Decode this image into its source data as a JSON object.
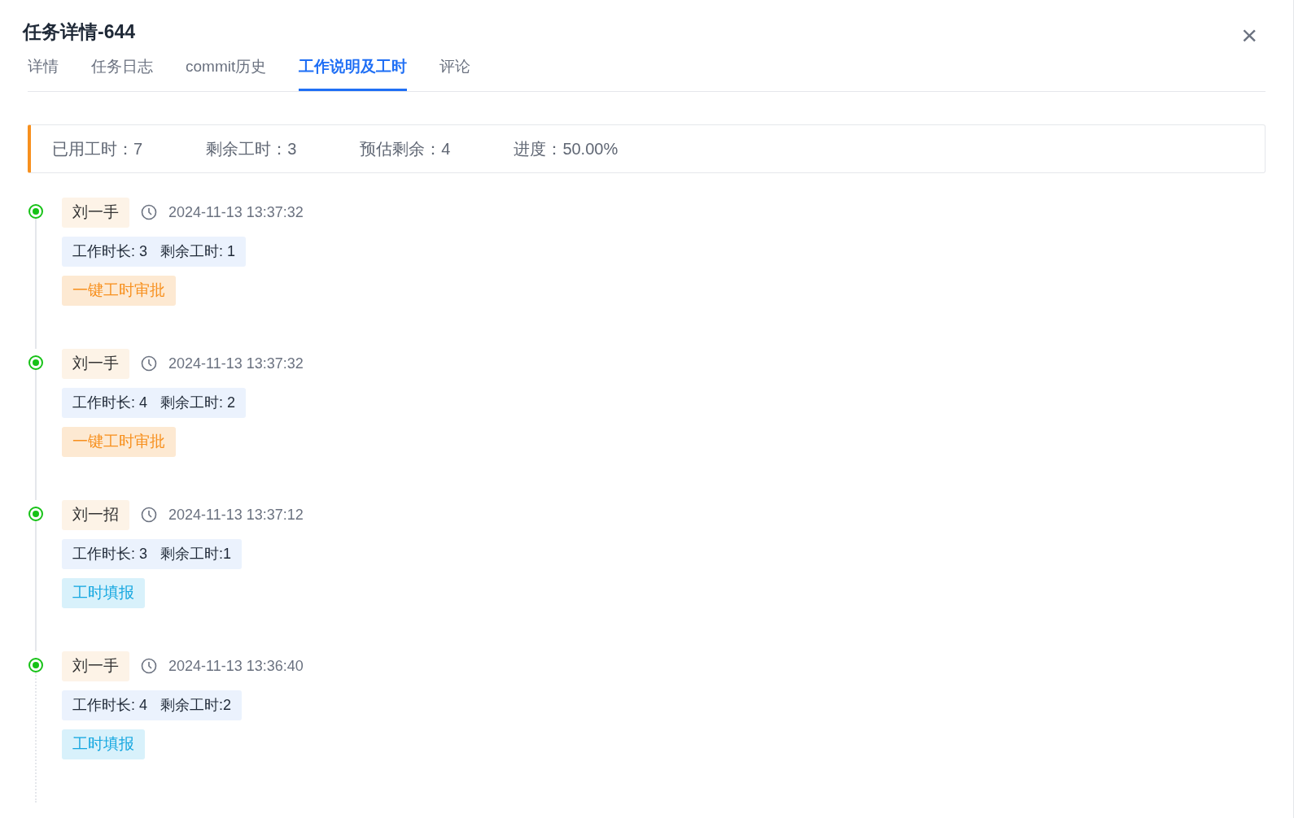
{
  "dialog": {
    "title": "任务详情-644",
    "close": "×"
  },
  "tabs": [
    {
      "label": "详情",
      "selected": false
    },
    {
      "label": "任务日志",
      "selected": false
    },
    {
      "label": "commit历史",
      "selected": false
    },
    {
      "label": "工作说明及工时",
      "selected": true
    },
    {
      "label": "评论",
      "selected": false
    }
  ],
  "summary": [
    "已用工时：7",
    "剩余工时：3",
    "预估剩余：4",
    "进度：50.00%"
  ],
  "timeline": [
    {
      "user": "刘一手",
      "time": "2024-11-13 13:37:32",
      "hours": "工作时长: 3",
      "remaining": "剩余工时: 1",
      "tag": "一键工时审批",
      "kind": "approval"
    },
    {
      "user": "刘一手",
      "time": "2024-11-13 13:37:32",
      "hours": "工作时长: 4",
      "remaining": "剩余工时: 2",
      "tag": "一键工时审批",
      "kind": "approval"
    },
    {
      "user": "刘一招",
      "time": "2024-11-13 13:37:12",
      "hours": "工作时长: 3",
      "remaining": "剩余工时:1",
      "tag": "工时填报",
      "kind": "report"
    },
    {
      "user": "刘一手",
      "time": "2024-11-13 13:36:40",
      "hours": "工作时长: 4",
      "remaining": "剩余工时:2",
      "tag": "工时填报",
      "kind": "report"
    }
  ]
}
